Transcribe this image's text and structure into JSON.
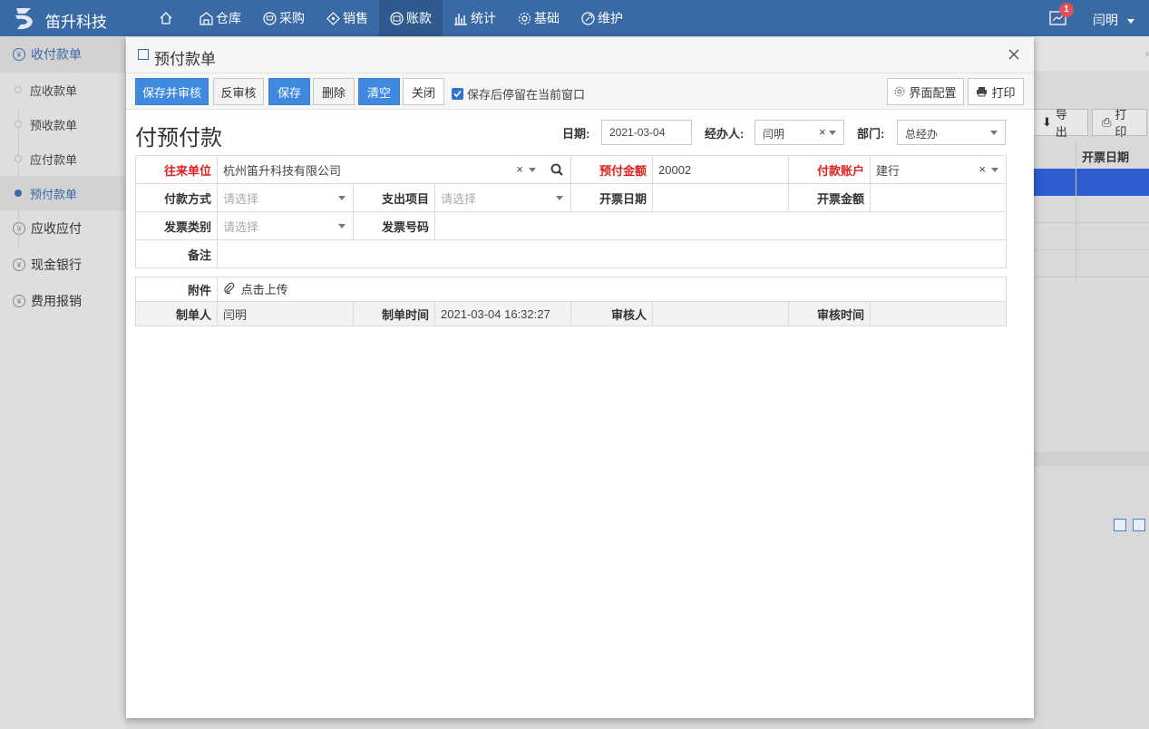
{
  "app": {
    "brand": "笛升科技",
    "user": "闫明",
    "notification_count": "1"
  },
  "nav": [
    {
      "label": "",
      "icon": "home-icon"
    },
    {
      "label": "仓库",
      "icon": "warehouse-icon"
    },
    {
      "label": "采购",
      "icon": "cart-icon"
    },
    {
      "label": "销售",
      "icon": "tag-icon"
    },
    {
      "label": "账款",
      "icon": "money-icon"
    },
    {
      "label": "统计",
      "icon": "bar-chart-icon"
    },
    {
      "label": "基础",
      "icon": "gear-icon"
    },
    {
      "label": "维护",
      "icon": "wrench-icon"
    }
  ],
  "sidebar": {
    "groups": [
      {
        "label": "收付款单",
        "items": [
          "应收款单",
          "预收款单",
          "应付款单",
          "预付款单"
        ]
      },
      {
        "label": "应收应付"
      },
      {
        "label": "现金银行"
      },
      {
        "label": "费用报销"
      }
    ]
  },
  "background": {
    "export_label": "导出",
    "print_label": "打印",
    "column_header": "开票日期"
  },
  "modal": {
    "title": "预付款单",
    "toolbar": {
      "save_approve": "保存并审核",
      "unapprove": "反审核",
      "save": "保存",
      "delete": "删除",
      "clear": "清空",
      "close": "关闭",
      "stay_after_save": "保存后停留在当前窗口",
      "ui_config": "界面配置",
      "print": "打印"
    },
    "form_title": "付预付款",
    "header": {
      "date_label": "日期:",
      "date_value": "2021-03-04",
      "handler_label": "经办人:",
      "handler_value": "闫明",
      "dept_label": "部门:",
      "dept_value": "总经办"
    },
    "fields": {
      "partner_label": "往来单位",
      "partner_value": "杭州笛升科技有限公司",
      "prepay_amount_label": "预付金额",
      "prepay_amount_value": "20002",
      "pay_account_label": "付款账户",
      "pay_account_value": "建行",
      "pay_method_label": "付款方式",
      "pay_method_placeholder": "请选择",
      "expense_item_label": "支出项目",
      "expense_item_placeholder": "请选择",
      "invoice_date_label": "开票日期",
      "invoice_amount_label": "开票金额",
      "invoice_type_label": "发票类别",
      "invoice_type_placeholder": "请选择",
      "invoice_no_label": "发票号码",
      "remark_label": "备注",
      "attachment_label": "附件",
      "upload_label": "点击上传",
      "creator_label": "制单人",
      "creator_value": "闫明",
      "created_time_label": "制单时间",
      "created_time_value": "2021-03-04 16:32:27",
      "approver_label": "审核人",
      "approved_time_label": "审核时间"
    }
  }
}
